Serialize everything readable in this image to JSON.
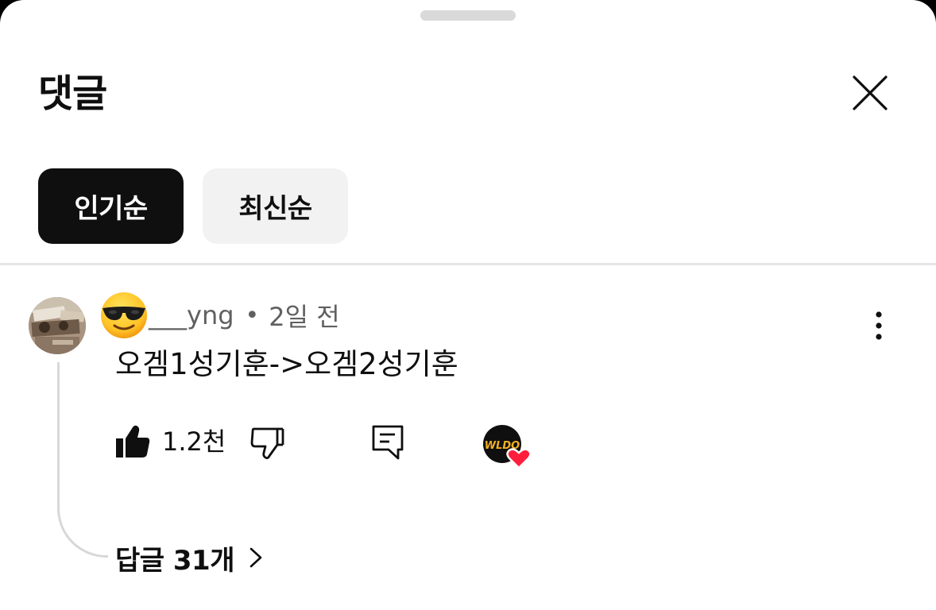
{
  "header": {
    "title": "댓글"
  },
  "sort_chips": [
    {
      "label": "인기순",
      "selected": true
    },
    {
      "label": "최신순",
      "selected": false
    }
  ],
  "comment": {
    "author": "___yng",
    "author_emoji": "smiling-face-with-sunglasses",
    "separator": "•",
    "time": "2일 전",
    "text": "오겜1성기훈->오겜2성기훈",
    "like_count": "1.2천",
    "creator_badge_text": "WLDO",
    "replies_label": "답글 31개"
  },
  "colors": {
    "primary_text": "#0f0f0f",
    "secondary_text": "#606060",
    "chip_active_bg": "#0f0f0f",
    "chip_inactive_bg": "#f2f2f2",
    "heart": "#ff1f3d",
    "badge_text": "#f2b01e"
  },
  "icons": {
    "close": "close-icon",
    "more": "more-vert-icon",
    "like": "thumbs-up-filled-icon",
    "dislike": "thumbs-down-outline-icon",
    "reply": "comment-icon",
    "replies_chevron": "chevron-right-icon"
  }
}
